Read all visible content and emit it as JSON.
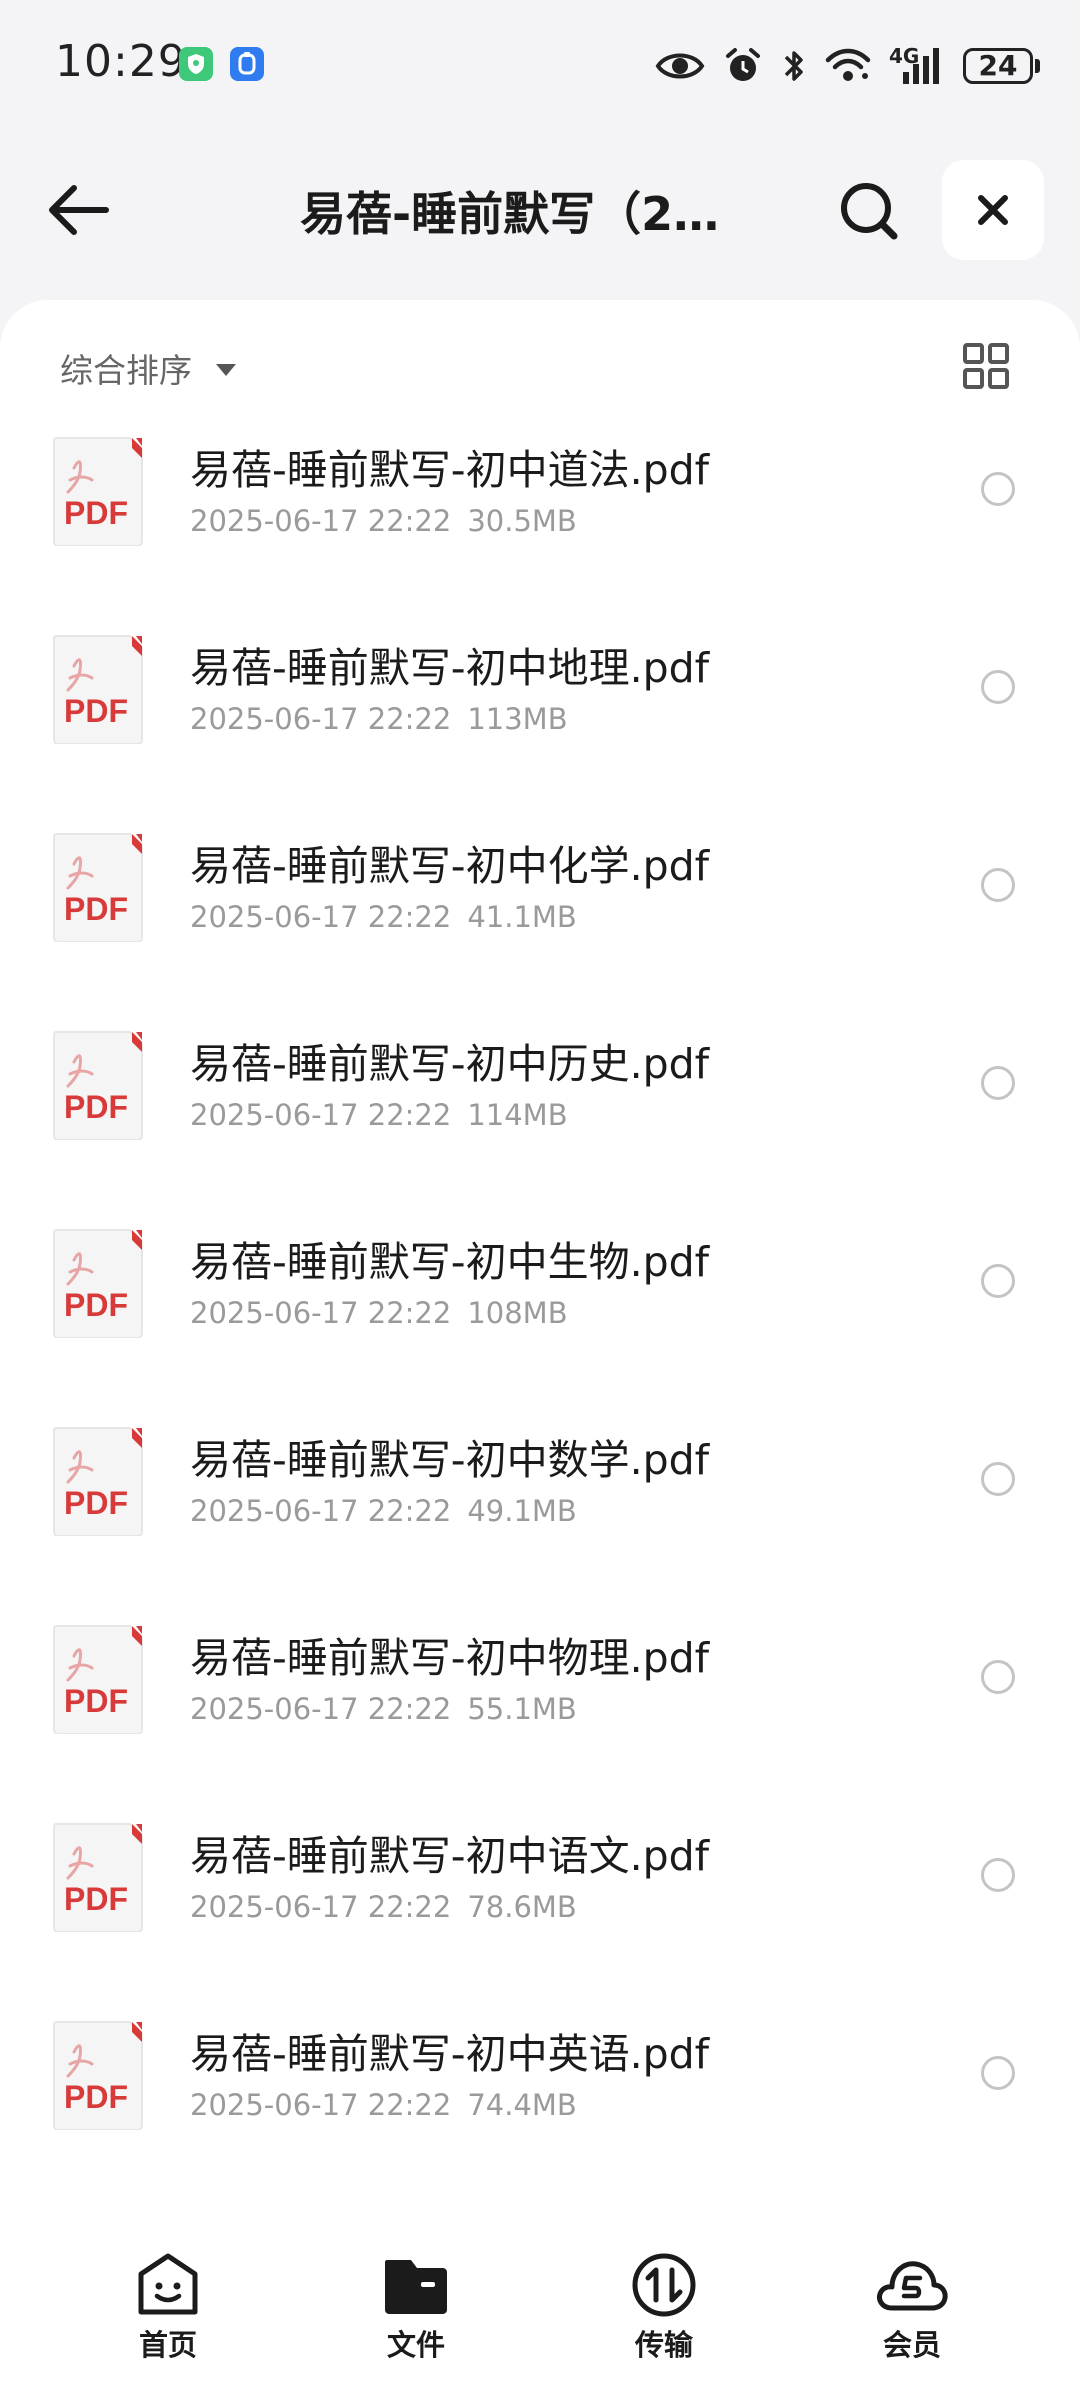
{
  "status_bar": {
    "time": "10:29",
    "network": "4G",
    "battery": "24",
    "icons": [
      "shield-app-icon",
      "blue-app-icon",
      "eye-icon",
      "alarm-icon",
      "bluetooth-icon",
      "wifi-icon",
      "signal-icon",
      "battery-icon"
    ]
  },
  "header": {
    "title": "易蓓-睡前默写（2…",
    "icons": [
      "back-arrow-icon",
      "search-icon",
      "close-icon"
    ]
  },
  "toolbar": {
    "sort_label": "综合排序",
    "icons": [
      "sort-caret-icon",
      "grid-view-icon"
    ]
  },
  "files": [
    {
      "name": "易蓓-睡前默写-初中道法.pdf",
      "date": "2025-06-17 22:22",
      "size": "30.5MB"
    },
    {
      "name": "易蓓-睡前默写-初中地理.pdf",
      "date": "2025-06-17 22:22",
      "size": "113MB"
    },
    {
      "name": "易蓓-睡前默写-初中化学.pdf",
      "date": "2025-06-17 22:22",
      "size": "41.1MB"
    },
    {
      "name": "易蓓-睡前默写-初中历史.pdf",
      "date": "2025-06-17 22:22",
      "size": "114MB"
    },
    {
      "name": "易蓓-睡前默写-初中生物.pdf",
      "date": "2025-06-17 22:22",
      "size": "108MB"
    },
    {
      "name": "易蓓-睡前默写-初中数学.pdf",
      "date": "2025-06-17 22:22",
      "size": "49.1MB"
    },
    {
      "name": "易蓓-睡前默写-初中物理.pdf",
      "date": "2025-06-17 22:22",
      "size": "55.1MB"
    },
    {
      "name": "易蓓-睡前默写-初中语文.pdf",
      "date": "2025-06-17 22:22",
      "size": "78.6MB"
    },
    {
      "name": "易蓓-睡前默写-初中英语.pdf",
      "date": "2025-06-17 22:22",
      "size": "74.4MB"
    }
  ],
  "file_icon_label": "PDF",
  "nav": {
    "items": [
      {
        "label": "首页",
        "icon": "home-face-icon"
      },
      {
        "label": "文件",
        "icon": "folder-icon"
      },
      {
        "label": "传输",
        "icon": "transfer-icon"
      },
      {
        "label": "会员",
        "icon": "vip-cloud-icon"
      }
    ],
    "active": "文件"
  },
  "colors": {
    "pdf_red": "#d83a3a",
    "background": "#f4f4f6",
    "secondary_text": "#9a9a9a"
  }
}
